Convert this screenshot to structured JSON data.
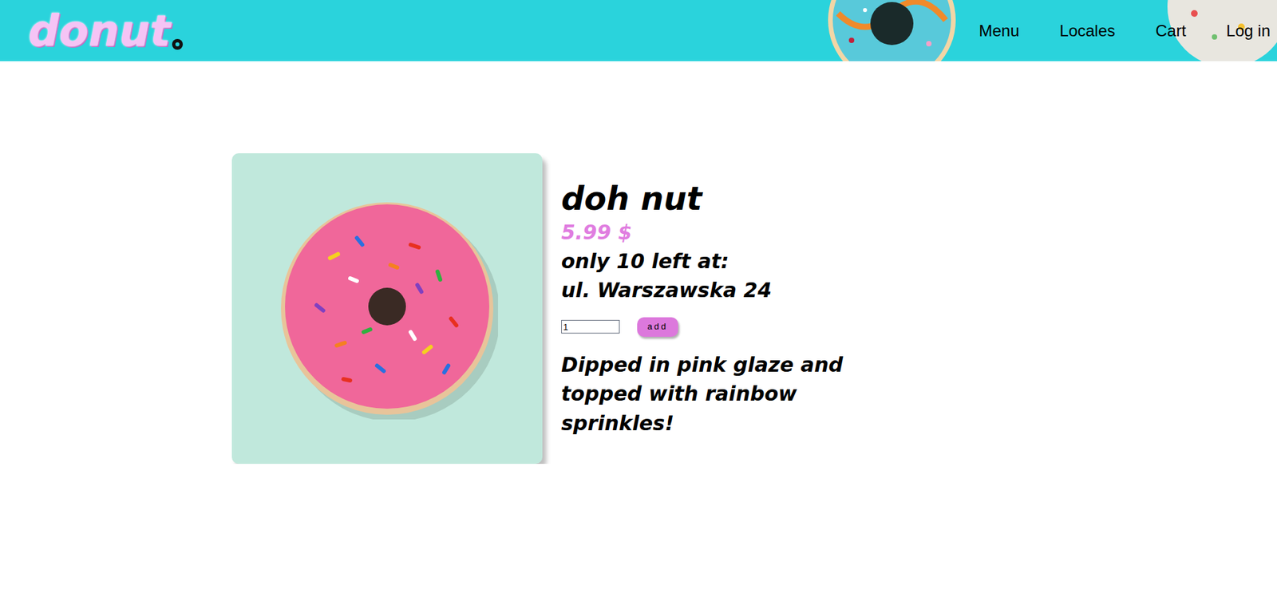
{
  "header": {
    "logo": "donut",
    "nav": [
      {
        "label": "Menu"
      },
      {
        "label": "Locales"
      },
      {
        "label": "Cart"
      },
      {
        "label": "Log in"
      }
    ]
  },
  "product": {
    "name": "doh nut",
    "price": "5.99 $",
    "stock": "only 10 left at:",
    "address": "ul. Warszawska 24",
    "quantity": "1",
    "button": "add",
    "description": "Dipped in pink glaze and topped with rainbow sprinkles!"
  }
}
